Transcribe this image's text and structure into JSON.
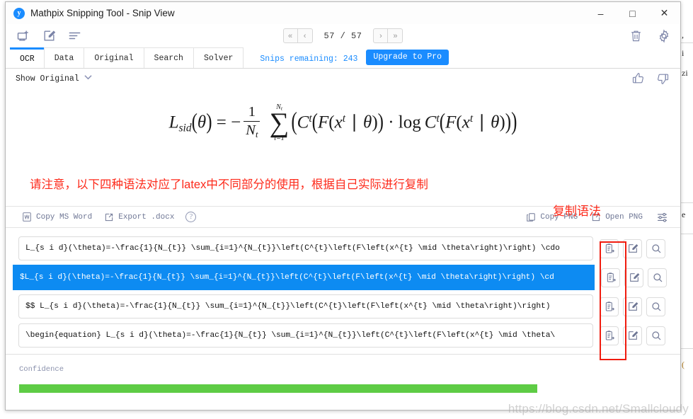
{
  "window": {
    "title": "Mathpix Snipping Tool - Snip View",
    "logo_glyph": "y",
    "minimize_label": "–",
    "maximize_label": "□",
    "close_label": "✕"
  },
  "toolbar": {
    "icons": [
      {
        "name": "new-snip-icon",
        "label": "New Snip"
      },
      {
        "name": "edit-icon",
        "label": "Edit"
      },
      {
        "name": "list-icon",
        "label": "List"
      }
    ],
    "right_icons": [
      {
        "name": "trash-icon",
        "label": "Delete"
      },
      {
        "name": "gear-icon",
        "label": "Settings"
      }
    ]
  },
  "pager": {
    "first_label": "«",
    "prev_label": "‹",
    "next_label": "›",
    "last_label": "»",
    "count": "57 / 57",
    "current": 57,
    "total": 57
  },
  "tabs": [
    {
      "label": "OCR",
      "active": true
    },
    {
      "label": "Data",
      "active": false
    },
    {
      "label": "Original",
      "active": false
    },
    {
      "label": "Search",
      "active": false
    },
    {
      "label": "Solver",
      "active": false
    }
  ],
  "snips": {
    "remaining_text": "Snips remaining: 243",
    "remaining_count": 243,
    "upgrade_label": "Upgrade to Pro",
    "accent": "#1a8cff"
  },
  "show_original": {
    "label": "Show Original",
    "chevron": "⌄"
  },
  "feedback": {
    "thumbs_up": "thumbs-up-icon",
    "thumbs_down": "thumbs-down-icon"
  },
  "formula": {
    "lhs_L": "L",
    "lhs_sub": "sid",
    "theta": "θ",
    "equals": "=",
    "minus": "−",
    "frac_num": "1",
    "frac_den_N": "N",
    "frac_den_sub": "t",
    "sum_upper_N": "N",
    "sum_upper_sub": "t",
    "sum_glyph": "∑",
    "sum_lower": "i=1",
    "C": "C",
    "t": "t",
    "F": "F",
    "x": "x",
    "mid": "∣",
    "dot": "·",
    "log": "log"
  },
  "annotations": {
    "note_main": "请注意，以下四种语法对应了latex中不同部分的使用，根据自己实际进行复制",
    "note_copy": "复制语法",
    "note_color": "#fd2a1b"
  },
  "actionbar": {
    "copy_ms_word": "Copy MS Word",
    "export_docx": "Export .docx",
    "help": "?",
    "copy_png": "Copy PNG",
    "open_png": "Open PNG",
    "settings_icon": "sliders-icon"
  },
  "results": {
    "rows": [
      {
        "text": "L_{s i d}(\\theta)=-\\frac{1}{N_{t}} \\sum_{i=1}^{N_{t}}\\left(C^{t}\\left(F\\left(x^{t} \\mid \\theta\\right)\\right) \\cdo",
        "selected": false
      },
      {
        "text": "$L_{s i d}(\\theta)=-\\frac{1}{N_{t}} \\sum_{i=1}^{N_{t}}\\left(C^{t}\\left(F\\left(x^{t} \\mid \\theta\\right)\\right) \\cd",
        "selected": true
      },
      {
        "text": "$$  L_{s i d}(\\theta)=-\\frac{1}{N_{t}} \\sum_{i=1}^{N_{t}}\\left(C^{t}\\left(F\\left(x^{t} \\mid \\theta\\right)\\right)",
        "selected": false
      },
      {
        "text": "\\begin{equation}  L_{s i d}(\\theta)=-\\frac{1}{N_{t}} \\sum_{i=1}^{N_{t}}\\left(C^{t}\\left(F\\left(x^{t} \\mid \\theta\\",
        "selected": false
      }
    ],
    "row_icons": [
      {
        "name": "copy-to-clipboard-icon"
      },
      {
        "name": "edit-icon"
      },
      {
        "name": "search-icon"
      }
    ]
  },
  "confidence": {
    "label": "Confidence",
    "percent": 80,
    "fill_color": "#5ecc45"
  },
  "watermark": {
    "text": "https://blog.csdn.net/Smallcloudy"
  },
  "background_doc": {
    "fragments": [
      ",",
      "i",
      "zi",
      "e",
      "("
    ]
  }
}
